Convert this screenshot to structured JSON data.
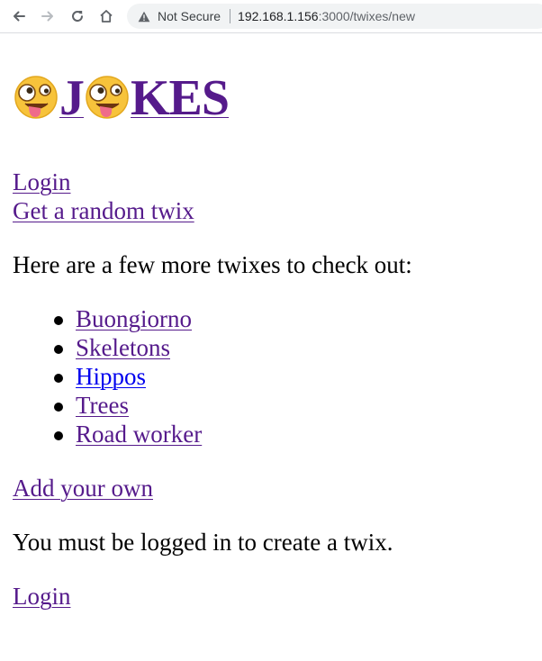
{
  "browser": {
    "not_secure_label": "Not Secure",
    "url_host": "192.168.1.156",
    "url_path": ":3000/twixes/new"
  },
  "header": {
    "title_letter_j": "J",
    "title_rest": "KES"
  },
  "nav": {
    "login_label": "Login",
    "random_label": "Get a random twix"
  },
  "main": {
    "intro": "Here are a few more twixes to check out:",
    "twixes": [
      {
        "label": "Buongiorno"
      },
      {
        "label": "Skeletons"
      },
      {
        "label": "Hippos"
      },
      {
        "label": "Trees"
      },
      {
        "label": "Road worker"
      }
    ],
    "add_label": "Add your own",
    "message": "You must be logged in to create a twix.",
    "login_label": "Login"
  },
  "colors": {
    "visited_link": "#551a8b",
    "unvisited_link": "#0000ee"
  },
  "icons": {
    "back": "back-arrow-icon",
    "forward": "forward-arrow-icon",
    "reload": "reload-icon",
    "home": "home-icon",
    "warning": "warning-triangle-icon",
    "emoji": "zany-face-emoji-icon"
  }
}
